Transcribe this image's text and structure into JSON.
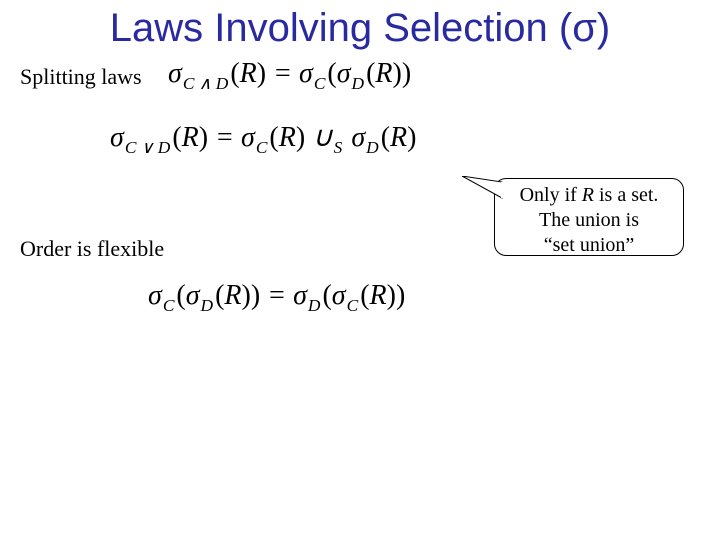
{
  "title": "Laws Involving Selection (σ)",
  "labels": {
    "splitting": "Splitting laws",
    "order": "Order is flexible"
  },
  "equations": {
    "sig": "σ",
    "R": "R",
    "eq": " = ",
    "lpar": "(",
    "rpar": ")",
    "sub_and": "C ∧ D",
    "sub_or": "C ∨ D",
    "sub_C": "C",
    "sub_D": "D",
    "union": " ∪",
    "sub_S": "S"
  },
  "callout": {
    "line1a": "Only if ",
    "line1b": "R",
    "line1c": " is a set.",
    "line2": "The union is",
    "line3": "“set union”"
  }
}
